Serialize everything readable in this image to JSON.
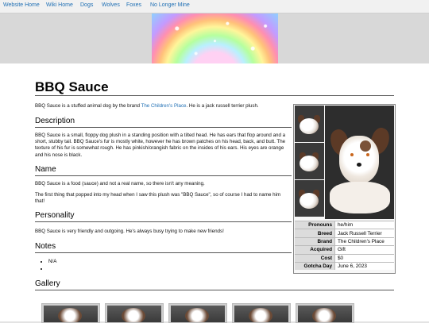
{
  "nav": [
    "Website Home",
    "Wiki Home",
    "Dogs",
    "Wolves",
    "Foxes",
    "No Longer Mine"
  ],
  "page": {
    "title": "BBQ Sauce",
    "intro_before": "BBQ Sauce is a stuffed animal dog by the brand ",
    "intro_link": "The Children's Place",
    "intro_after": ". He is a jack russell terrier plush."
  },
  "sections": {
    "description": {
      "heading": "Description",
      "text": "BBQ Sauce is a small, floppy dog plush in a standing position with a tilted head. He has ears that flop around and a short, stubby tail. BBQ Sauce's fur is mostly white, however he has brown patches on his head, back, and butt. The texture of his fur is somewhat rough. He has pinkish/orangish fabric on the insides of his ears. His eyes are orange and his nose is black."
    },
    "name": {
      "heading": "Name",
      "text1": "BBQ Sauce is a food (sauce) and not a real name, so there isn't any meaning.",
      "text2": "The first thing that popped into my head when I saw this plush was \"BBQ Sauce\", so of course I had to name him that!"
    },
    "personality": {
      "heading": "Personality",
      "text": "BBQ Sauce is very friendly and outgoing. He's always busy trying to make new friends!"
    },
    "notes": {
      "heading": "Notes",
      "items": [
        "N/A",
        ""
      ]
    },
    "gallery": {
      "heading": "Gallery"
    }
  },
  "infobox": {
    "rows": [
      {
        "key": "Pronouns",
        "value": "he/him"
      },
      {
        "key": "Breed",
        "value": "Jack Russell Terrier"
      },
      {
        "key": "Brand",
        "value": "The Children's Place"
      },
      {
        "key": "Acquired",
        "value": "Gift"
      },
      {
        "key": "Cost",
        "value": "$0"
      },
      {
        "key": "Gotcha Day",
        "value": "June 6, 2023"
      }
    ]
  },
  "colors": {
    "link": "#1f6fb4",
    "page_bg": "#e3e3e3",
    "content_bg": "#ffffff"
  }
}
